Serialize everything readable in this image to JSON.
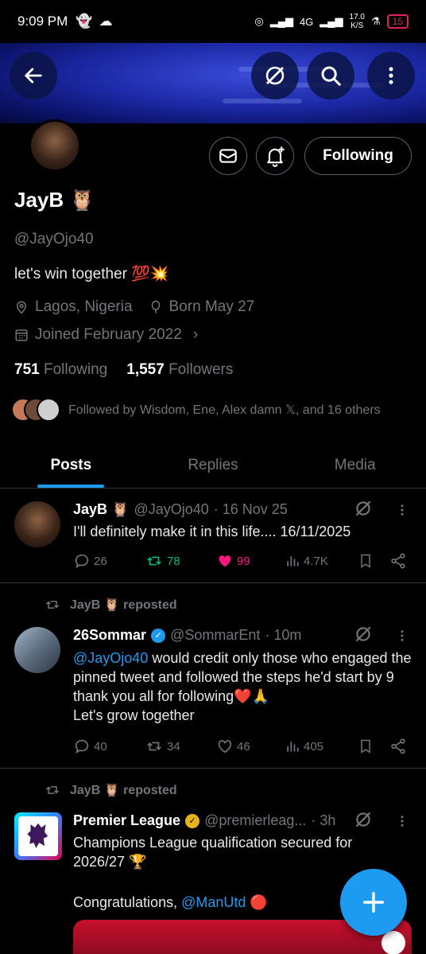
{
  "status_bar": {
    "time": "9:09 PM",
    "network": "4G",
    "speed": "17.0",
    "speed_unit": "K/S",
    "battery": "15"
  },
  "profile": {
    "name": "JayB",
    "name_emoji": "🦉",
    "handle": "@JayOjo40",
    "bio": "let's win together 💯💥",
    "location": "Lagos, Nigeria",
    "born": "Born May 27",
    "joined": "Joined February 2022",
    "following_count": "751",
    "following_label": "Following",
    "followers_count": "1,557",
    "followers_label": "Followers",
    "followed_by": "Followed by Wisdom, Ene, Alex damn 𝕏, and 16 others",
    "follow_button": "Following"
  },
  "tabs": [
    {
      "label": "Posts",
      "active": true
    },
    {
      "label": "Replies",
      "active": false
    },
    {
      "label": "Media",
      "active": false
    }
  ],
  "posts": [
    {
      "author": "JayB 🦉",
      "handle": "@JayOjo40",
      "time": "· 16 Nov 25",
      "text": "I'll definitely make it in this life.... 16/11/2025",
      "replies": "26",
      "reposts": "78",
      "likes": "99",
      "views": "4.7K"
    },
    {
      "repost_by": "JayB 🦉 reposted",
      "author": "26Sommar",
      "handle": "@SommarEnt",
      "time": "· 10m",
      "mention": "@JayOjo40",
      "text_line1": " would credit only those who engaged the pinned tweet and followed the steps he'd start by 9 thank you all for following❤️🙏",
      "text_line2": "Let's grow together",
      "replies": "40",
      "reposts": "34",
      "likes": "46",
      "views": "405"
    },
    {
      "repost_by": "JayB 🦉 reposted",
      "author": "Premier League",
      "handle": "@premierleag...",
      "time": "· 3h",
      "text": "Champions League qualification secured for 2026/27 🏆",
      "text2_prefix": "Congratulations, ",
      "mention": "@ManUtd",
      "text2_suffix": " 🔴"
    }
  ],
  "colors": {
    "accent": "#1d9bf0",
    "like": "#f91880",
    "repost": "#00ba7c"
  }
}
